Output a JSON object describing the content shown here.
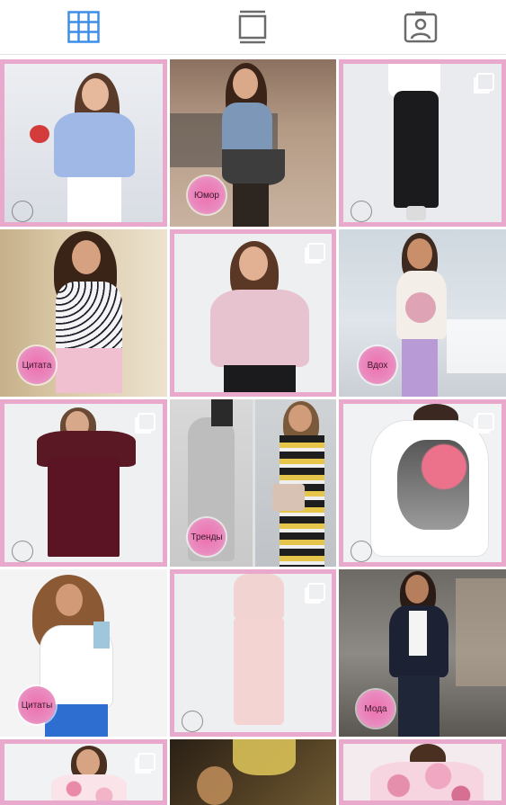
{
  "tabs": [
    {
      "name": "grid-view-icon",
      "active": true
    },
    {
      "name": "feed-view-icon",
      "active": false
    },
    {
      "name": "tagged-view-icon",
      "active": false
    }
  ],
  "colors": {
    "accent": "#3d8ee8",
    "frame": "#e8a9cc",
    "badge": "#ee6fae",
    "inactive": "#6b6b6b"
  },
  "badges": {
    "humor": "Юмор",
    "quote": "Цитата",
    "inspiration": "Вдох",
    "trends": "Тренды",
    "quotes": "Цитаты",
    "fashion": "Мода"
  },
  "posts": [
    {
      "id": "post-1",
      "subject": "blue-peasant-blouse"
    },
    {
      "id": "post-2",
      "subject": "street-style-skirt",
      "badge": "humor"
    },
    {
      "id": "post-3",
      "subject": "black-jeans",
      "multi": true
    },
    {
      "id": "post-4",
      "subject": "polka-dot-top",
      "badge": "quote"
    },
    {
      "id": "post-5",
      "subject": "pink-ruffle-blouse",
      "multi": true
    },
    {
      "id": "post-6",
      "subject": "floral-tank",
      "badge": "inspiration"
    },
    {
      "id": "post-7",
      "subject": "burgundy-dress",
      "multi": true
    },
    {
      "id": "post-8",
      "subject": "knit-dress-collage",
      "badge": "trends"
    },
    {
      "id": "post-9",
      "subject": "rose-print-tee",
      "multi": true
    },
    {
      "id": "post-10",
      "subject": "white-tee",
      "badge": "quotes"
    },
    {
      "id": "post-11",
      "subject": "pink-trousers",
      "multi": true
    },
    {
      "id": "post-12",
      "subject": "navy-blazer",
      "badge": "fashion"
    },
    {
      "id": "post-13",
      "subject": "floral-top",
      "multi": true
    },
    {
      "id": "post-14",
      "subject": "yellow-floral"
    },
    {
      "id": "post-15",
      "subject": "pink-floral-dress"
    }
  ]
}
